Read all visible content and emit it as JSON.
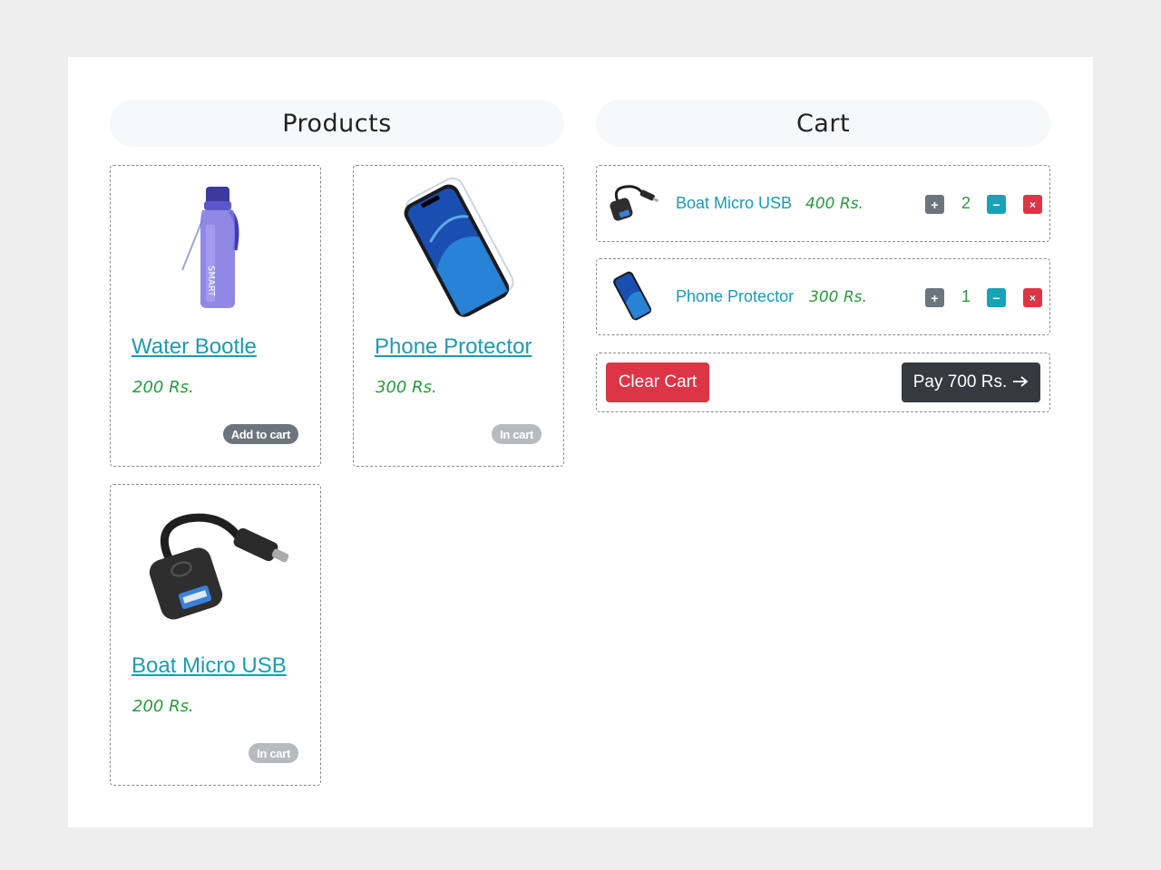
{
  "headings": {
    "products": "Products",
    "cart": "Cart"
  },
  "products": [
    {
      "name": "Water Bootle",
      "price": "200 Rs.",
      "status": "Add to cart",
      "image": "water-bottle"
    },
    {
      "name": "Phone Protector",
      "price": "300 Rs.",
      "status": "In cart",
      "image": "phone"
    },
    {
      "name": "Boat Micro USB",
      "price": "200 Rs.",
      "status": "In cart",
      "image": "usb-adapter"
    }
  ],
  "cart": {
    "items": [
      {
        "name": "Boat Micro USB",
        "price": "400 Rs.",
        "qty": "2",
        "image": "usb-adapter"
      },
      {
        "name": "Phone Protector",
        "price": "300 Rs.",
        "qty": "1",
        "image": "phone"
      }
    ],
    "buttons": {
      "plus": "+",
      "minus": "−",
      "remove": "×"
    },
    "clear_label": "Clear Cart",
    "pay_label": "Pay 700 Rs.",
    "pay_icon": "arrow-right-icon"
  },
  "colors": {
    "link": "#1c9bb4",
    "price": "#2a9a3f",
    "danger": "#dc3545",
    "secondary": "#6c757d",
    "info": "#17a2b8",
    "dark": "#343a40"
  }
}
